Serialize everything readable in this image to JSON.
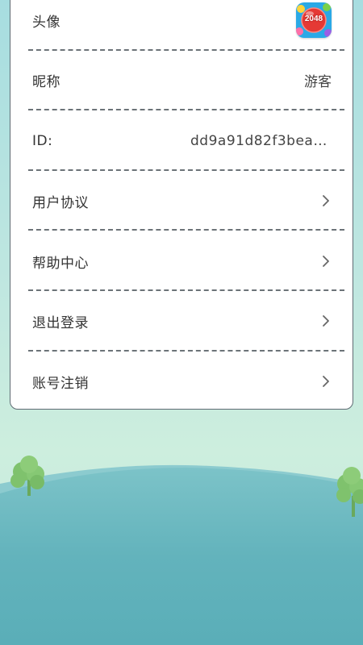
{
  "settings": {
    "rows": [
      {
        "label": "头像",
        "avatar_text": "2048",
        "avatar_icon": "game-2048-app-icon"
      },
      {
        "label": "昵称",
        "value": "游客"
      },
      {
        "label": "ID:",
        "value": "dd9a91d82f3beaf…"
      },
      {
        "label": "用户协议",
        "icon": "chevron-right-icon"
      },
      {
        "label": "帮助中心",
        "icon": "chevron-right-icon"
      },
      {
        "label": "退出登录",
        "icon": "chevron-right-icon"
      },
      {
        "label": "账号注销",
        "icon": "chevron-right-icon"
      }
    ]
  },
  "colors": {
    "sky": "#a7dde0",
    "hill_front": "#6cb9c2",
    "hill_back": "#8fcdd0",
    "tree": "#7fc26d",
    "card_border": "#5f6b73",
    "divider": "#6c7378"
  }
}
